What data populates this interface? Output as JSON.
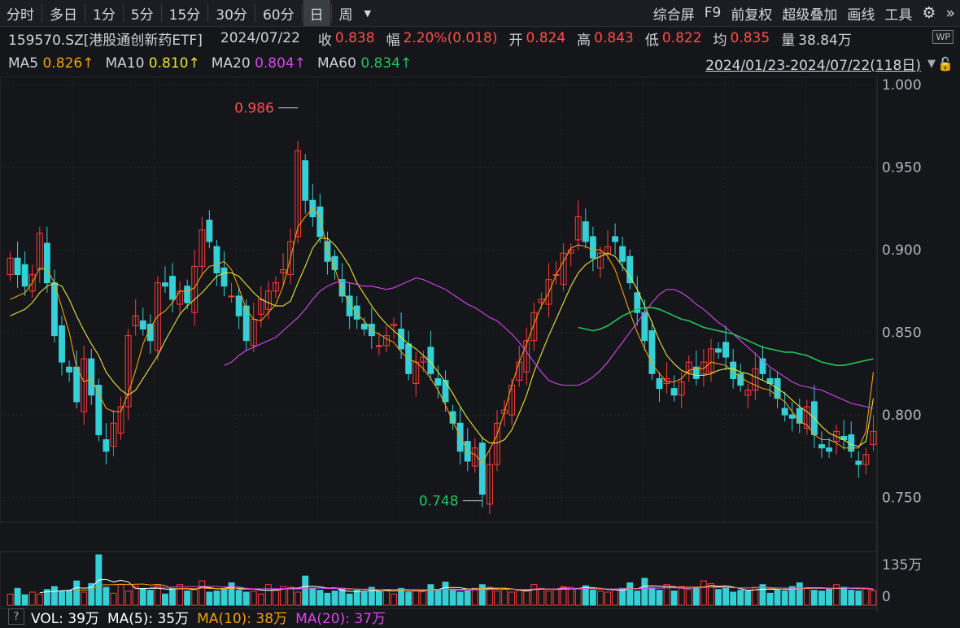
{
  "toolbar": {
    "tabs": [
      "分时",
      "多日",
      "1分",
      "5分",
      "15分",
      "30分",
      "60分",
      "日",
      "周"
    ],
    "active_tab": "日",
    "dropdown_icon": "caret-down-icon",
    "right": [
      "综合屏",
      "F9",
      "前复权",
      "超级叠加",
      "画线",
      "工具"
    ],
    "settings_icon": "gear-icon",
    "expand_icon": "double-chevron-right-icon"
  },
  "quote": {
    "code": "159570.SZ[港股通创新药ETF]",
    "date": "2024/07/22",
    "close_label": "收",
    "close": "0.838",
    "change_label": "幅",
    "change": "2.20%(0.018)",
    "open_label": "开",
    "open": "0.824",
    "high_label": "高",
    "high": "0.843",
    "low_label": "低",
    "low": "0.822",
    "avg_label": "均",
    "avg": "0.835",
    "vol_label": "量",
    "vol": "38.84万",
    "badge": "WP"
  },
  "ma_legend": {
    "ma5_label": "MA5",
    "ma5": "0.826↑",
    "ma10_label": "MA10",
    "ma10": "0.810↑",
    "ma20_label": "MA20",
    "ma20": "0.804↑",
    "ma60_label": "MA60",
    "ma60": "0.834↑",
    "range": "2024/01/23-2024/07/22(118日)",
    "lock_icon": "lock-icon"
  },
  "colors": {
    "up": "#ff3b3b",
    "down": "#35d0d6",
    "ma5": "#ffffff",
    "ma10": "#e8e23a",
    "ma20": "#d946ef",
    "ma60": "#22c55e",
    "vma10": "#f59e0b",
    "vma20": "#d946ef"
  },
  "volume_header": {
    "help": "?",
    "vol_label": "VOL: 39万",
    "ma5_label": "MA(5): 35万",
    "ma10_label": "MA(10): 38万",
    "ma20_label": "MA(20): 37万"
  },
  "chart_data": [
    {
      "type": "candlestick",
      "ylim": [
        0.735,
        1.005
      ],
      "yticks": [
        "1.000",
        "0.950",
        "0.900",
        "0.850",
        "0.800",
        "0.750"
      ],
      "annotations": [
        {
          "text": "0.986",
          "color": "#ff4d4d"
        },
        {
          "text": "0.748",
          "color": "#22c55e"
        }
      ],
      "close": [
        0.895,
        0.885,
        0.878,
        0.885,
        0.91,
        0.88,
        0.848,
        0.832,
        0.826,
        0.808,
        0.834,
        0.812,
        0.788,
        0.778,
        0.795,
        0.805,
        0.848,
        0.86,
        0.852,
        0.845,
        0.88,
        0.878,
        0.87,
        0.875,
        0.868,
        0.89,
        0.912,
        0.905,
        0.886,
        0.878,
        0.872,
        0.86,
        0.845,
        0.858,
        0.87,
        0.875,
        0.88,
        0.888,
        0.905,
        0.96,
        0.93,
        0.92,
        0.908,
        0.893,
        0.888,
        0.872,
        0.86,
        0.858,
        0.852,
        0.848,
        0.842,
        0.848,
        0.855,
        0.84,
        0.825,
        0.832,
        0.835,
        0.825,
        0.818,
        0.808,
        0.795,
        0.778,
        0.772,
        0.78,
        0.752,
        0.77,
        0.795,
        0.803,
        0.818,
        0.832,
        0.845,
        0.862,
        0.87,
        0.882,
        0.885,
        0.898,
        0.9,
        0.92,
        0.905,
        0.895,
        0.898,
        0.902,
        0.905,
        0.893,
        0.88,
        0.862,
        0.845,
        0.825,
        0.816,
        0.822,
        0.812,
        0.82,
        0.832,
        0.822,
        0.832,
        0.84,
        0.838,
        0.835,
        0.822,
        0.818,
        0.815,
        0.828,
        0.825,
        0.819,
        0.81,
        0.8,
        0.798,
        0.795,
        0.805,
        0.788,
        0.78,
        0.778,
        0.79,
        0.785,
        0.778,
        0.77,
        0.776,
        0.79
      ],
      "ma5": [
        0.87,
        0.872,
        0.874,
        0.88,
        0.889,
        0.888,
        0.88,
        0.865,
        0.85,
        0.829,
        0.82,
        0.822,
        0.813,
        0.804,
        0.802,
        0.802,
        0.813,
        0.827,
        0.843,
        0.853,
        0.86,
        0.863,
        0.868,
        0.875,
        0.875,
        0.877,
        0.885,
        0.89,
        0.891,
        0.893,
        0.888,
        0.877,
        0.864,
        0.858,
        0.857,
        0.862,
        0.867,
        0.878,
        0.895,
        0.914,
        0.92,
        0.925,
        0.92,
        0.9,
        0.889,
        0.875,
        0.868,
        0.861,
        0.857,
        0.851,
        0.849,
        0.846,
        0.844,
        0.838,
        0.834,
        0.832,
        0.828,
        0.822,
        0.815,
        0.806,
        0.796,
        0.787,
        0.778,
        0.776,
        0.771,
        0.779,
        0.788,
        0.802,
        0.818,
        0.832,
        0.843,
        0.855,
        0.866,
        0.874,
        0.885,
        0.893,
        0.901,
        0.903,
        0.902,
        0.9,
        0.9,
        0.896,
        0.888,
        0.875,
        0.862,
        0.85,
        0.84,
        0.831,
        0.825,
        0.82,
        0.82,
        0.822,
        0.827,
        0.828,
        0.828,
        0.832,
        0.831,
        0.83,
        0.826,
        0.823,
        0.82,
        0.818,
        0.816,
        0.815,
        0.811,
        0.808,
        0.802,
        0.796,
        0.794,
        0.788,
        0.785,
        0.785,
        0.783,
        0.78,
        0.78,
        0.78,
        0.79,
        0.826
      ],
      "ma10": [
        0.86,
        0.862,
        0.864,
        0.868,
        0.874,
        0.878,
        0.88,
        0.878,
        0.87,
        0.86,
        0.851,
        0.843,
        0.836,
        0.826,
        0.82,
        0.815,
        0.812,
        0.815,
        0.822,
        0.829,
        0.836,
        0.845,
        0.853,
        0.861,
        0.866,
        0.87,
        0.874,
        0.879,
        0.884,
        0.886,
        0.886,
        0.884,
        0.879,
        0.874,
        0.87,
        0.868,
        0.866,
        0.866,
        0.869,
        0.88,
        0.89,
        0.901,
        0.907,
        0.907,
        0.903,
        0.897,
        0.89,
        0.88,
        0.873,
        0.866,
        0.86,
        0.855,
        0.851,
        0.847,
        0.843,
        0.84,
        0.836,
        0.832,
        0.826,
        0.82,
        0.813,
        0.805,
        0.798,
        0.792,
        0.786,
        0.783,
        0.783,
        0.785,
        0.791,
        0.801,
        0.812,
        0.826,
        0.837,
        0.848,
        0.858,
        0.868,
        0.878,
        0.886,
        0.891,
        0.894,
        0.896,
        0.898,
        0.896,
        0.89,
        0.884,
        0.876,
        0.866,
        0.856,
        0.845,
        0.836,
        0.831,
        0.827,
        0.825,
        0.824,
        0.824,
        0.825,
        0.827,
        0.828,
        0.828,
        0.826,
        0.825,
        0.823,
        0.821,
        0.819,
        0.816,
        0.813,
        0.809,
        0.805,
        0.802,
        0.798,
        0.793,
        0.789,
        0.787,
        0.785,
        0.782,
        0.781,
        0.784,
        0.81
      ],
      "ma20": [
        null,
        null,
        null,
        null,
        null,
        null,
        null,
        null,
        null,
        null,
        null,
        null,
        null,
        null,
        null,
        null,
        0.83,
        0.832,
        0.836,
        0.839,
        0.841,
        0.843,
        0.845,
        0.847,
        0.851,
        0.855,
        0.859,
        0.864,
        0.87,
        0.875,
        0.878,
        0.88,
        0.881,
        0.88,
        0.879,
        0.878,
        0.878,
        0.877,
        0.876,
        0.877,
        0.879,
        0.881,
        0.883,
        0.882,
        0.88,
        0.878,
        0.876,
        0.873,
        0.87,
        0.867,
        0.865,
        0.862,
        0.859,
        0.857,
        0.853,
        0.849,
        0.844,
        0.838,
        0.832,
        0.826,
        0.821,
        0.819,
        0.818,
        0.818,
        0.818,
        0.82,
        0.823,
        0.827,
        0.832,
        0.838,
        0.844,
        0.85,
        0.856,
        0.862,
        0.868,
        0.873,
        0.876,
        0.876,
        0.874,
        0.871,
        0.867,
        0.864,
        0.86,
        0.856,
        0.853,
        0.849,
        0.845,
        0.841,
        0.837,
        0.833,
        0.829,
        0.826,
        0.823,
        0.82,
        0.818,
        0.817,
        0.816,
        0.815,
        0.813,
        0.811,
        0.809,
        0.807,
        0.806,
        0.805,
        0.804
      ],
      "ma60": [
        null,
        null,
        null,
        null,
        null,
        null,
        null,
        null,
        null,
        null,
        null,
        null,
        null,
        null,
        null,
        null,
        null,
        null,
        null,
        null,
        null,
        null,
        null,
        null,
        null,
        null,
        null,
        null,
        null,
        null,
        null,
        null,
        null,
        null,
        null,
        null,
        null,
        null,
        null,
        null,
        null,
        null,
        null,
        null,
        null,
        null,
        null,
        null,
        null,
        null,
        null,
        null,
        null,
        null,
        null,
        null,
        null,
        null,
        0.853,
        0.852,
        0.851,
        0.852,
        0.854,
        0.857,
        0.86,
        0.862,
        0.864,
        0.865,
        0.865,
        0.864,
        0.862,
        0.86,
        0.858,
        0.857,
        0.855,
        0.853,
        0.852,
        0.851,
        0.85,
        0.849,
        0.847,
        0.845,
        0.843,
        0.841,
        0.84,
        0.839,
        0.838,
        0.838,
        0.837,
        0.836,
        0.834,
        0.832,
        0.831,
        0.83,
        0.83,
        0.831,
        0.832,
        0.833,
        0.834
      ]
    },
    {
      "type": "bar",
      "ylim": [
        0,
        135
      ],
      "yticks": [
        "135万",
        "0"
      ],
      "values": [
        30,
        45,
        28,
        35,
        30,
        42,
        50,
        38,
        40,
        65,
        35,
        58,
        140,
        48,
        32,
        55,
        38,
        50,
        45,
        40,
        52,
        30,
        45,
        55,
        38,
        42,
        65,
        35,
        38,
        45,
        60,
        40,
        35,
        38,
        30,
        55,
        42,
        50,
        48,
        35,
        78,
        45,
        40,
        32,
        38,
        45,
        30,
        40,
        35,
        48,
        38,
        42,
        30,
        45,
        35,
        40,
        38,
        55,
        42,
        62,
        40,
        35,
        38,
        45,
        55,
        48,
        38,
        42,
        35,
        40,
        38,
        55,
        45,
        38,
        42,
        50,
        48,
        45,
        52,
        40,
        38,
        35,
        42,
        45,
        60,
        38,
        72,
        45,
        40,
        55,
        38,
        50,
        42,
        48,
        65,
        58,
        42,
        45,
        35,
        40,
        38,
        48,
        55,
        32,
        42,
        38,
        50,
        60,
        45,
        40,
        38,
        45,
        55,
        48,
        40,
        38,
        45,
        39
      ]
    }
  ]
}
